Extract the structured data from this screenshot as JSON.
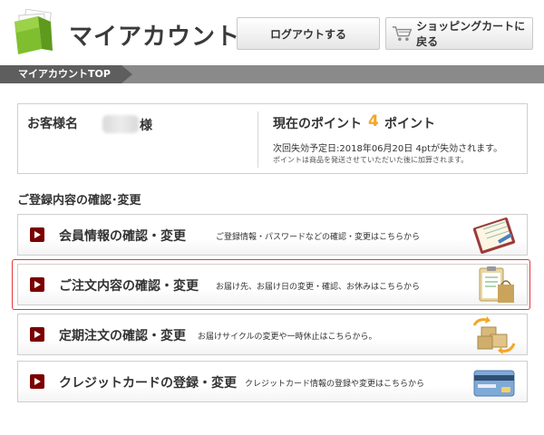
{
  "header": {
    "title": "マイアカウント",
    "logout_label": "ログアウトする",
    "cart_label": "ショッピングカートに戻る",
    "logo_icon": "folder-icon",
    "cart_icon": "shopping-cart-icon"
  },
  "breadcrumb": {
    "current": "マイアカウントTOP"
  },
  "customer": {
    "label": "お客様名",
    "suffix": "様"
  },
  "points": {
    "label": "現在のポイント",
    "value": "4",
    "unit": "ポイント",
    "expiry_note": "次回失効予定日:2018年06月20日 4ptが失効されます。",
    "add_note": "ポイントは商品を発送させていただいた後に加算されます。"
  },
  "section": {
    "heading": "ご登録内容の確認･変更"
  },
  "menu": [
    {
      "title": "会員情報の確認・変更",
      "desc": "ご登録情報・パスワードなどの確認・変更はこちらから",
      "icon": "notebook-icon"
    },
    {
      "title": "ご注文内容の確認・変更",
      "desc": "お届け先、お届け日の変更・確認、お休みはこちらから",
      "icon": "clipboard-bag-icon"
    },
    {
      "title": "定期注文の確認・変更",
      "desc": "お届けサイクルの変更や一時休止はこちらから。",
      "icon": "boxes-cycle-icon"
    },
    {
      "title": "クレジットカードの登録・変更",
      "desc": "クレジットカード情報の登録や変更はこちらから",
      "icon": "credit-card-icon"
    }
  ],
  "colors": {
    "accent_arrow": "#7a0000",
    "points_value": "#f5a623",
    "highlight": "#e0393e",
    "logo_green": "#8cc63f"
  }
}
